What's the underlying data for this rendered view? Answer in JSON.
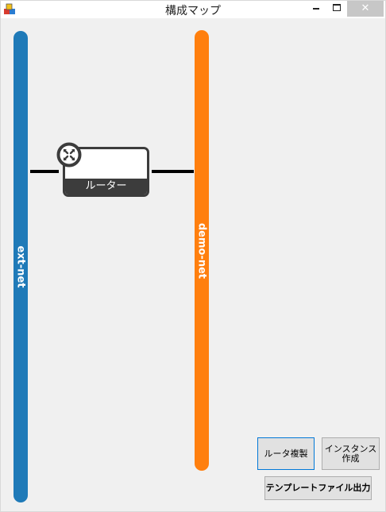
{
  "window": {
    "title": "構成マップ",
    "close_glyph": "✕",
    "icon": "app-icon"
  },
  "networks": [
    {
      "name": "ext-net",
      "color": "#1f7ab8"
    },
    {
      "name": "demo-net",
      "color": "#ff7f0e"
    }
  ],
  "router": {
    "label": "ルーター",
    "icon": "router-icon"
  },
  "buttons": {
    "copy_router": "ルータ複製",
    "create_instance_line1": "インスタンス",
    "create_instance_line2": "作成",
    "template_output": "テンプレートファイル出力"
  }
}
